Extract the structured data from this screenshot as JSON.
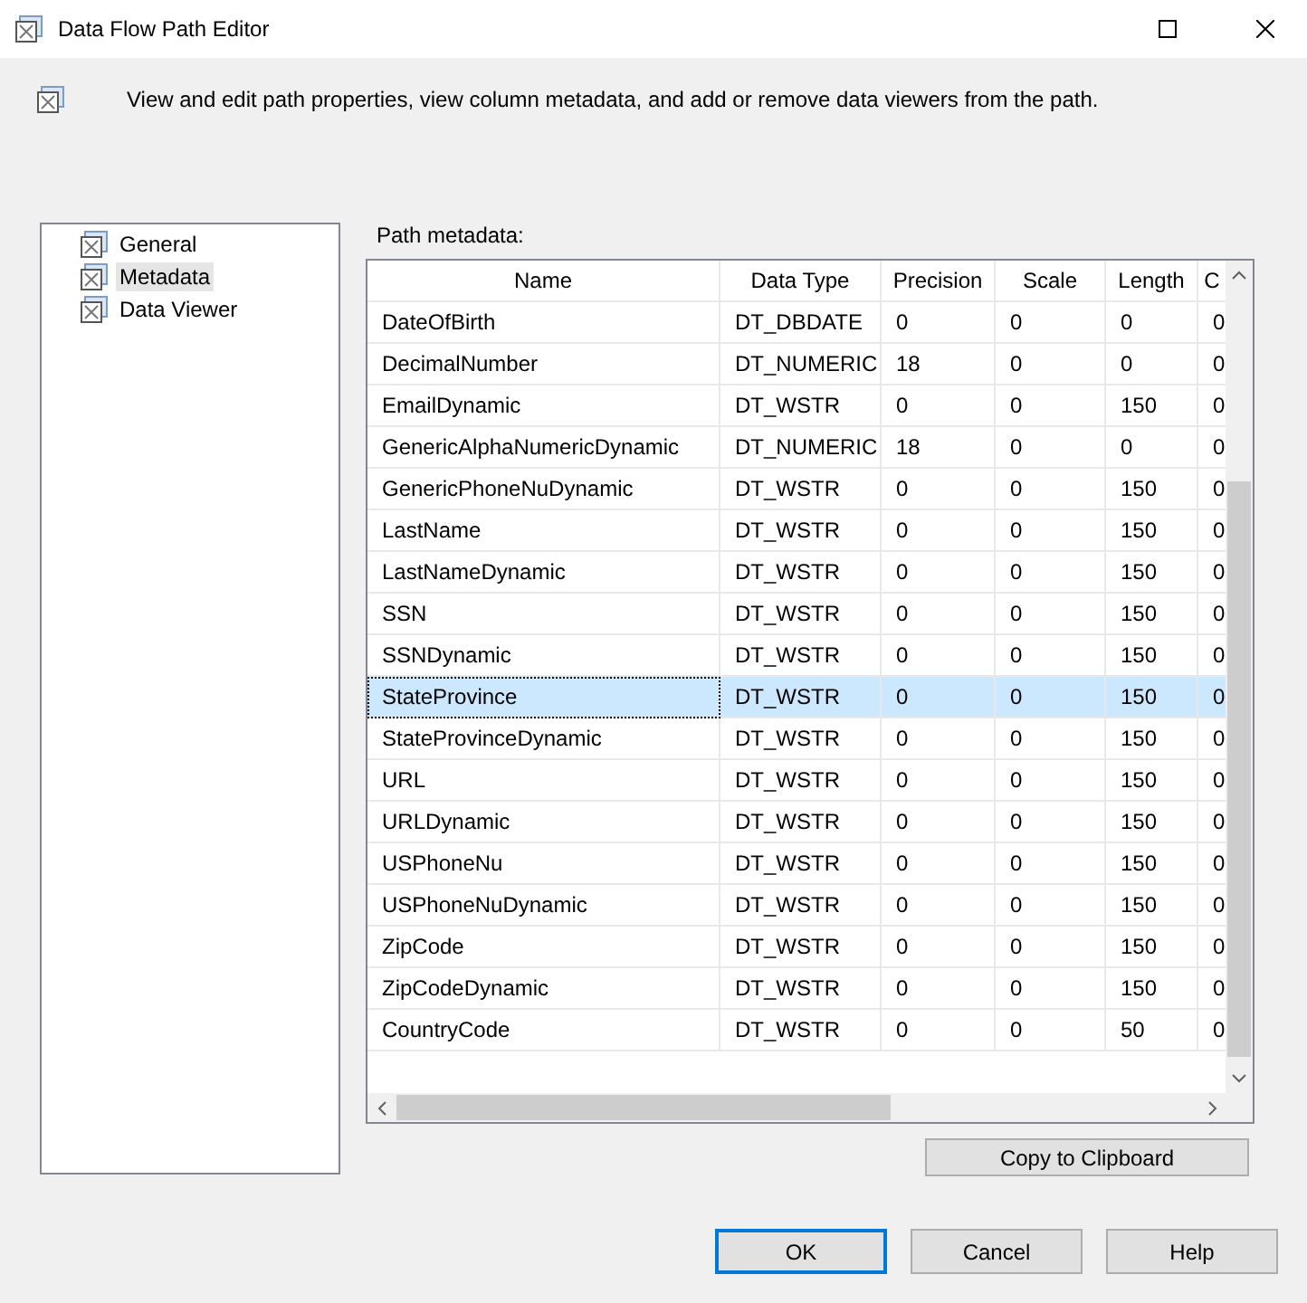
{
  "window": {
    "title": "Data Flow Path Editor"
  },
  "description": "View and edit path properties, view column metadata, and add or remove data viewers from the path.",
  "sidebar": {
    "items": [
      {
        "label": "General",
        "selected": false
      },
      {
        "label": "Metadata",
        "selected": true
      },
      {
        "label": "Data Viewer",
        "selected": false
      }
    ]
  },
  "table": {
    "label": "Path metadata:",
    "columns": [
      "Name",
      "Data Type",
      "Precision",
      "Scale",
      "Length",
      "C"
    ],
    "rows": [
      {
        "cells": [
          "DateOfBirth",
          "DT_DBDATE",
          "0",
          "0",
          "0",
          "0"
        ],
        "selected": false
      },
      {
        "cells": [
          "DecimalNumber",
          "DT_NUMERIC",
          "18",
          "0",
          "0",
          "0"
        ],
        "selected": false
      },
      {
        "cells": [
          "EmailDynamic",
          "DT_WSTR",
          "0",
          "0",
          "150",
          "0"
        ],
        "selected": false
      },
      {
        "cells": [
          "GenericAlphaNumericDynamic",
          "DT_NUMERIC",
          "18",
          "0",
          "0",
          "0"
        ],
        "selected": false
      },
      {
        "cells": [
          "GenericPhoneNuDynamic",
          "DT_WSTR",
          "0",
          "0",
          "150",
          "0"
        ],
        "selected": false
      },
      {
        "cells": [
          "LastName",
          "DT_WSTR",
          "0",
          "0",
          "150",
          "0"
        ],
        "selected": false
      },
      {
        "cells": [
          "LastNameDynamic",
          "DT_WSTR",
          "0",
          "0",
          "150",
          "0"
        ],
        "selected": false
      },
      {
        "cells": [
          "SSN",
          "DT_WSTR",
          "0",
          "0",
          "150",
          "0"
        ],
        "selected": false
      },
      {
        "cells": [
          "SSNDynamic",
          "DT_WSTR",
          "0",
          "0",
          "150",
          "0"
        ],
        "selected": false
      },
      {
        "cells": [
          "StateProvince",
          "DT_WSTR",
          "0",
          "0",
          "150",
          "0"
        ],
        "selected": true
      },
      {
        "cells": [
          "StateProvinceDynamic",
          "DT_WSTR",
          "0",
          "0",
          "150",
          "0"
        ],
        "selected": false
      },
      {
        "cells": [
          "URL",
          "DT_WSTR",
          "0",
          "0",
          "150",
          "0"
        ],
        "selected": false
      },
      {
        "cells": [
          "URLDynamic",
          "DT_WSTR",
          "0",
          "0",
          "150",
          "0"
        ],
        "selected": false
      },
      {
        "cells": [
          "USPhoneNu",
          "DT_WSTR",
          "0",
          "0",
          "150",
          "0"
        ],
        "selected": false
      },
      {
        "cells": [
          "USPhoneNuDynamic",
          "DT_WSTR",
          "0",
          "0",
          "150",
          "0"
        ],
        "selected": false
      },
      {
        "cells": [
          "ZipCode",
          "DT_WSTR",
          "0",
          "0",
          "150",
          "0"
        ],
        "selected": false
      },
      {
        "cells": [
          "ZipCodeDynamic",
          "DT_WSTR",
          "0",
          "0",
          "150",
          "0"
        ],
        "selected": false
      },
      {
        "cells": [
          "CountryCode",
          "DT_WSTR",
          "0",
          "0",
          "50",
          "0"
        ],
        "selected": false
      }
    ]
  },
  "copy_button": "Copy to Clipboard",
  "buttons": [
    {
      "label": "OK",
      "default": true
    },
    {
      "label": "Cancel",
      "default": false
    },
    {
      "label": "Help",
      "default": false
    }
  ]
}
